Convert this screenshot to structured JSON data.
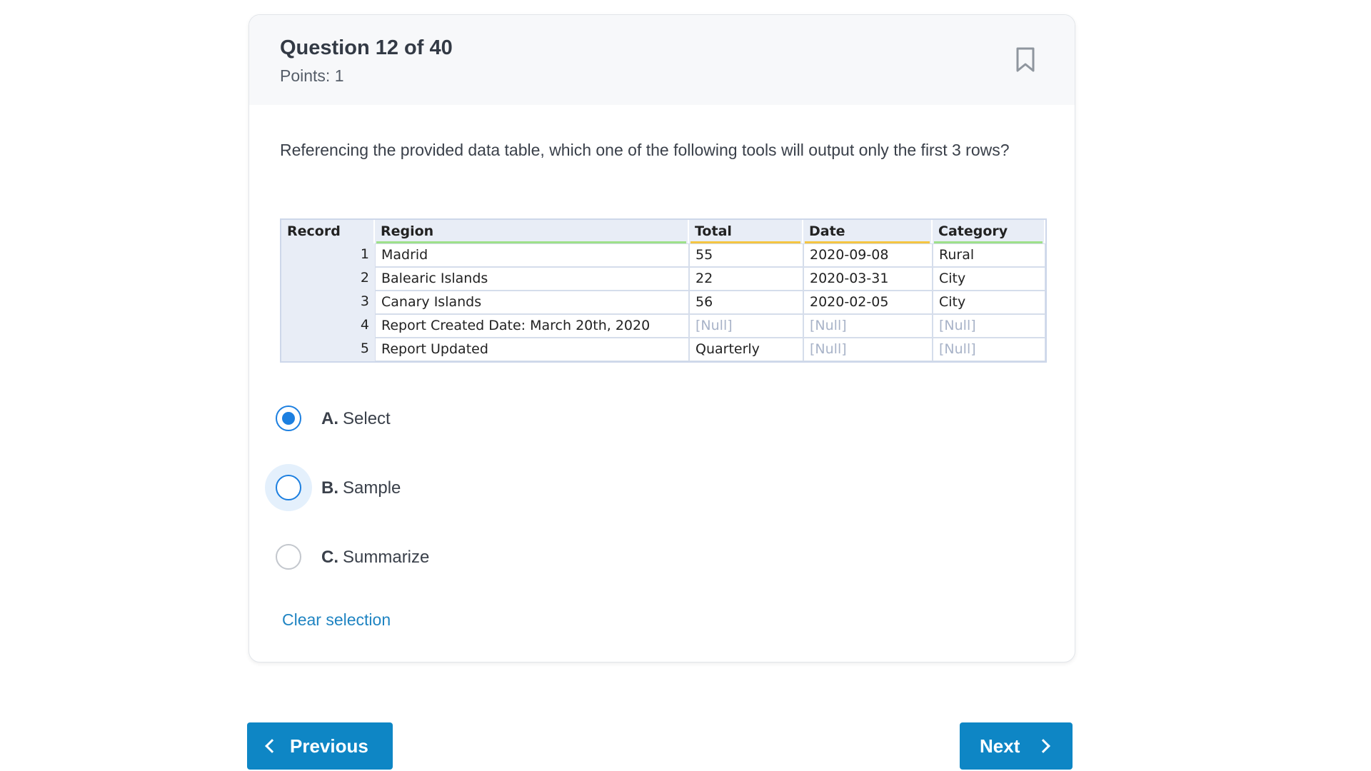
{
  "question": {
    "title": "Question 12 of 40",
    "points": "Points: 1",
    "text": "Referencing the provided data table, which one of the following tools will output only the first 3 rows?",
    "bookmark_icon": "bookmark-icon"
  },
  "data_table": {
    "headers": [
      "Record",
      "Region",
      "Total",
      "Date",
      "Category"
    ],
    "header_underline_colors": [
      "",
      "#9ee08a",
      "#f5c542",
      "#f5c542",
      "#9ee08a"
    ],
    "rows": [
      [
        "1",
        "Madrid",
        "55",
        "2020-09-08",
        "Rural"
      ],
      [
        "2",
        "Balearic Islands",
        "22",
        "2020-03-31",
        "City"
      ],
      [
        "3",
        "Canary Islands",
        "56",
        "2020-02-05",
        "City"
      ],
      [
        "4",
        "Report Created Date: March 20th, 2020",
        "[Null]",
        "[Null]",
        "[Null]"
      ],
      [
        "5",
        "Report Updated",
        "Quarterly",
        "[Null]",
        "[Null]"
      ]
    ]
  },
  "options": [
    {
      "letter": "A.",
      "label": "Select",
      "selected": true
    },
    {
      "letter": "B.",
      "label": "Sample",
      "selected": false
    },
    {
      "letter": "C.",
      "label": "Summarize",
      "selected": false
    }
  ],
  "clear_selection": "Clear selection",
  "nav": {
    "previous": "Previous",
    "next": "Next"
  },
  "colors": {
    "accent": "#1c7fe0",
    "button": "#0e86c5",
    "link": "#1f84c2"
  }
}
